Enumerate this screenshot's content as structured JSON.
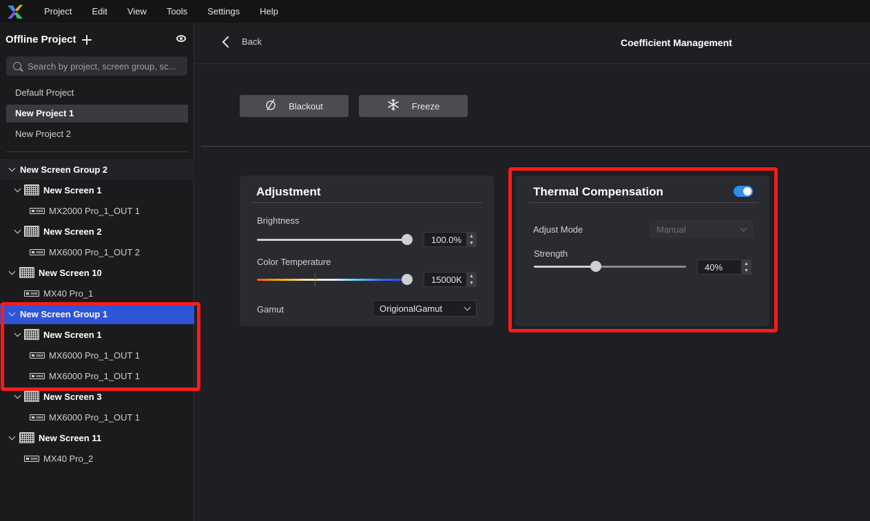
{
  "menu": [
    "Project",
    "Edit",
    "View",
    "Tools",
    "Settings",
    "Help"
  ],
  "sidebar": {
    "title": "Offline Project",
    "search_placeholder": "Search by project, screen group, sc...",
    "projects": [
      "Default Project",
      "New Project 1",
      "New Project 2"
    ],
    "active_project": "New Project 1",
    "tree": [
      {
        "type": "group",
        "label": "New Screen Group 2"
      },
      {
        "type": "screen",
        "label": "New Screen 1"
      },
      {
        "type": "device",
        "label": "MX2000 Pro_1_OUT 1"
      },
      {
        "type": "screen",
        "label": "New Screen 2"
      },
      {
        "type": "device",
        "label": "MX6000 Pro_1_OUT 2"
      },
      {
        "type": "screen",
        "label": "New Screen 10"
      },
      {
        "type": "device",
        "label": "MX40 Pro_1"
      },
      {
        "type": "group",
        "label": "New Screen Group 1"
      },
      {
        "type": "screen",
        "label": "New Screen 1"
      },
      {
        "type": "device",
        "label": "MX6000 Pro_1_OUT 1"
      },
      {
        "type": "device",
        "label": "MX6000 Pro_1_OUT 1"
      },
      {
        "type": "screen",
        "label": "New Screen 3"
      },
      {
        "type": "device",
        "label": "MX6000 Pro_1_OUT 1"
      },
      {
        "type": "screen",
        "label": "New Screen 11"
      },
      {
        "type": "device",
        "label": "MX40 Pro_2"
      }
    ]
  },
  "header": {
    "back_label": "Back",
    "title": "Coefficient Management"
  },
  "actions": {
    "blackout_label": "Blackout",
    "freeze_label": "Freeze"
  },
  "adjustment": {
    "title": "Adjustment",
    "brightness_label": "Brightness",
    "brightness_value": "100.0%",
    "color_temp_label": "Color Temperature",
    "color_temp_value": "15000K",
    "gamut_label": "Gamut",
    "gamut_value": "OrigionalGamut"
  },
  "thermal": {
    "title": "Thermal Compensation",
    "enabled": true,
    "adjust_mode_label": "Adjust Mode",
    "adjust_mode_value": "Manual",
    "strength_label": "Strength",
    "strength_value": "40%"
  },
  "colors": {
    "accent": "#2f8ff0",
    "selected": "#3054d8",
    "highlight_box": "#ff1a1a"
  }
}
